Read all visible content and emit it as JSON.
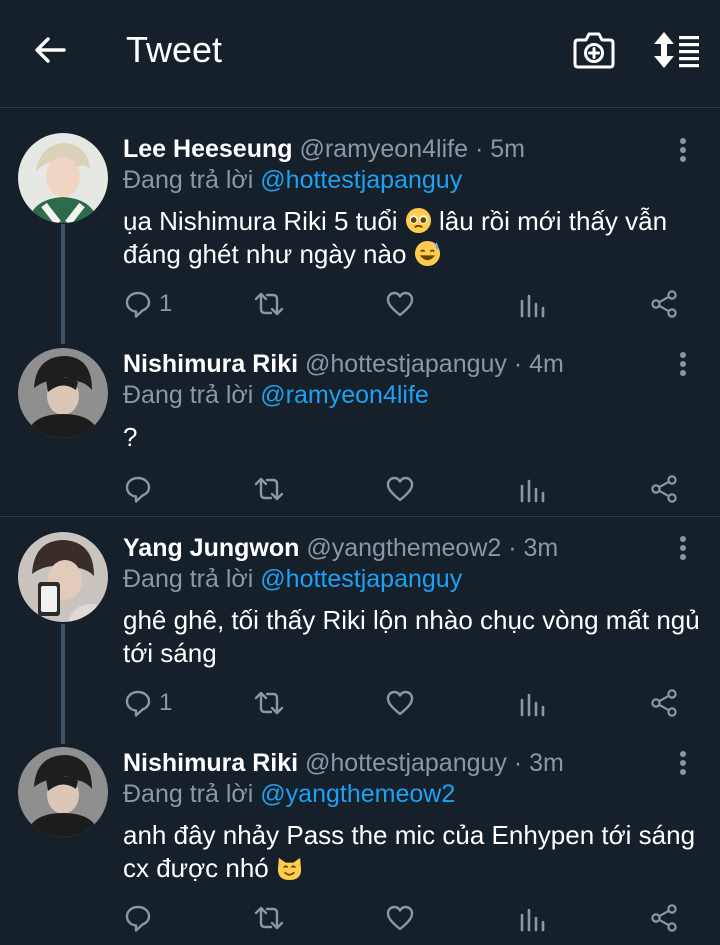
{
  "header": {
    "title": "Tweet",
    "back_icon": "arrow-left-icon",
    "camera_icon": "camera-plus-icon",
    "sort_icon": "sort-list-icon"
  },
  "colors": {
    "background": "#15202b",
    "muted": "#8899a6",
    "accent": "#1da1f2",
    "divider": "#2f3b47"
  },
  "tweets": [
    {
      "name": "Lee Heeseung",
      "handle": "@ramyeon4life",
      "dot": "·",
      "time": "5m",
      "reply_prefix": "Đang trả lời",
      "reply_to": "@hottestjapanguy",
      "text": "ụa Nishimura Riki 5 tuổi",
      "emoji1": "pleading-face",
      "text2": "lâu rồi mới thấy vẫn đáng ghét như ngày nào",
      "emoji2": "grinning-sweat-face",
      "reply_count": "1"
    },
    {
      "name": "Nishimura Riki",
      "handle": "@hottestjapanguy",
      "dot": "·",
      "time": "4m",
      "reply_prefix": "Đang trả lời",
      "reply_to": "@ramyeon4life",
      "text": "?",
      "reply_count": ""
    },
    {
      "name": "Yang Jungwon",
      "handle": "@yangthemeow2",
      "dot": "·",
      "time": "3m",
      "reply_prefix": "Đang trả lời",
      "reply_to": "@hottestjapanguy",
      "text": "ghê ghê, tối thấy Riki lộn nhào chục vòng mất ngủ tới sáng",
      "reply_count": "1"
    },
    {
      "name": "Nishimura Riki",
      "handle": "@hottestjapanguy",
      "dot": "·",
      "time": "3m",
      "reply_prefix": "Đang trả lời",
      "reply_to": "@yangthemeow2",
      "text": "anh đây nhảy Pass the mic của Enhypen tới sáng cx được nhó",
      "emoji1": "smiling-cat-face",
      "reply_count": ""
    }
  ]
}
